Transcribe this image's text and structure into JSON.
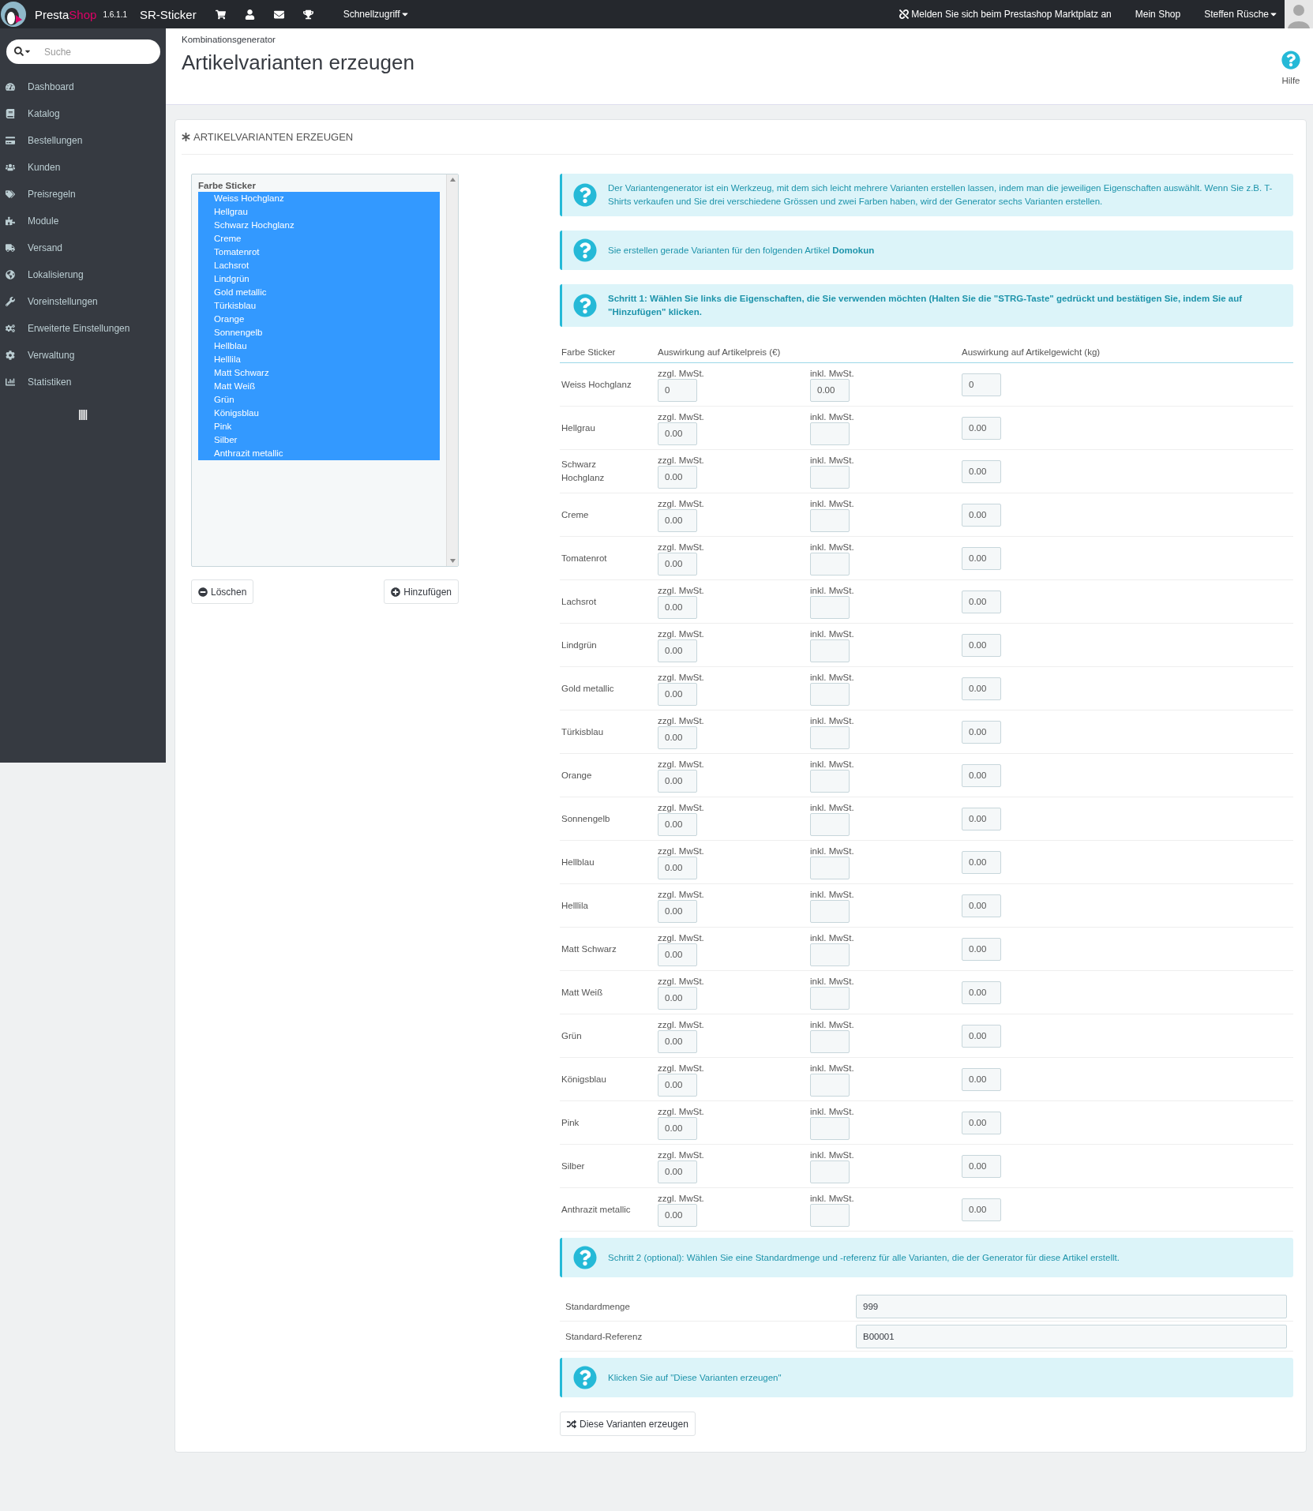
{
  "topbar": {
    "logo_main": "Presta",
    "logo_accent": "Shop",
    "version": "1.6.1.1",
    "shop_name": "SR-Sticker",
    "quick_access": "Schnellzugriff",
    "marketplace": "Melden Sie sich beim Prestashop Marktplatz an",
    "my_shop": "Mein Shop",
    "user": "Steffen Rüsche"
  },
  "sidebar": {
    "search_placeholder": "Suche",
    "items": [
      {
        "label": "Dashboard"
      },
      {
        "label": "Katalog"
      },
      {
        "label": "Bestellungen"
      },
      {
        "label": "Kunden"
      },
      {
        "label": "Preisregeln"
      },
      {
        "label": "Module"
      },
      {
        "label": "Versand"
      },
      {
        "label": "Lokalisierung"
      },
      {
        "label": "Voreinstellungen"
      },
      {
        "label": "Erweiterte Einstellungen"
      },
      {
        "label": "Verwaltung"
      },
      {
        "label": "Statistiken"
      }
    ]
  },
  "header": {
    "breadcrumb": "Kombinationsgenerator",
    "title": "Artikelvarianten erzeugen",
    "help": "Hilfe"
  },
  "panel": {
    "heading": "ARTIKELVARIANTEN ERZEUGEN",
    "attribute_list": {
      "group": "Farbe Sticker",
      "options": [
        {
          "label": "Weiss Hochglanz",
          "selected": true
        },
        {
          "label": "Hellgrau",
          "selected": true
        },
        {
          "label": "Schwarz Hochglanz",
          "selected": true
        },
        {
          "label": "Creme",
          "selected": true
        },
        {
          "label": "Tomatenrot",
          "selected": true
        },
        {
          "label": "Lachsrot",
          "selected": true
        },
        {
          "label": "Lindgrün",
          "selected": true
        },
        {
          "label": "Gold metallic",
          "selected": true
        },
        {
          "label": "Türkisblau",
          "selected": true
        },
        {
          "label": "Orange",
          "selected": true
        },
        {
          "label": "Sonnengelb",
          "selected": true
        },
        {
          "label": "Hellblau",
          "selected": true
        },
        {
          "label": "Helllila",
          "selected": true
        },
        {
          "label": "Matt Schwarz",
          "selected": true
        },
        {
          "label": "Matt Weiß",
          "selected": true
        },
        {
          "label": "Grün",
          "selected": true
        },
        {
          "label": "Königsblau",
          "selected": true
        },
        {
          "label": "Pink",
          "selected": true
        },
        {
          "label": "Silber",
          "selected": true
        },
        {
          "label": "Anthrazit metallic",
          "selected": true
        }
      ]
    },
    "delete_button": "Löschen",
    "add_button": "Hinzufügen",
    "infos": [
      {
        "text": "Der Variantengenerator ist ein Werkzeug, mit dem sich leicht mehrere Varianten erstellen lassen, indem man die jeweiligen Eigenschaften auswählt. Wenn Sie z.B. T-Shirts verkaufen und Sie drei verschiedene Grössen und zwei Farben haben, wird der Generator sechs Varianten erstellen.",
        "bold": false
      },
      {
        "text": "Sie erstellen gerade Varianten für den folgenden Artikel **Domokun**",
        "bold": false
      },
      {
        "text": "Schritt 1: Wählen Sie links die Eigenschaften, die Sie verwenden möchten (Halten Sie die \"STRG-Taste\" gedrückt und bestätigen Sie, indem Sie auf \"Hinzufügen\" klicken.",
        "bold": true
      }
    ],
    "table": {
      "columns": [
        "Farbe Sticker",
        "Auswirkung auf Artikelpreis (€)",
        "Auswirkung auf Artikelgewicht (kg)"
      ],
      "rows": [
        {
          "name": "Weiss Hochglanz",
          "excl_label": "zzgl. MwSt.",
          "excl": "0",
          "incl_label": "inkl. MwSt.",
          "incl": "0.00",
          "weight": "0"
        },
        {
          "name": "Hellgrau",
          "excl_label": "zzgl. MwSt.",
          "excl": "0.00",
          "incl_label": "inkl. MwSt.",
          "weight": "0.00"
        },
        {
          "name": "Schwarz Hochglanz",
          "excl_label": "zzgl. MwSt.",
          "excl": "0.00",
          "incl_label": "inkl. MwSt.",
          "weight": "0.00"
        },
        {
          "name": "Creme",
          "excl_label": "zzgl. MwSt.",
          "excl": "0.00",
          "incl_label": "inkl. MwSt.",
          "weight": "0.00"
        },
        {
          "name": "Tomatenrot",
          "excl_label": "zzgl. MwSt.",
          "excl": "0.00",
          "incl_label": "inkl. MwSt.",
          "weight": "0.00"
        },
        {
          "name": "Lachsrot",
          "excl_label": "zzgl. MwSt.",
          "excl": "0.00",
          "incl_label": "inkl. MwSt.",
          "weight": "0.00"
        },
        {
          "name": "Lindgrün",
          "excl_label": "zzgl. MwSt.",
          "excl": "0.00",
          "incl_label": "inkl. MwSt.",
          "weight": "0.00"
        },
        {
          "name": "Gold metallic",
          "excl_label": "zzgl. MwSt.",
          "excl": "0.00",
          "incl_label": "inkl. MwSt.",
          "weight": "0.00"
        },
        {
          "name": "Türkisblau",
          "excl_label": "zzgl. MwSt.",
          "excl": "0.00",
          "incl_label": "inkl. MwSt.",
          "weight": "0.00"
        },
        {
          "name": "Orange",
          "excl_label": "zzgl. MwSt.",
          "excl": "0.00",
          "incl_label": "inkl. MwSt.",
          "weight": "0.00"
        },
        {
          "name": "Sonnengelb",
          "excl_label": "zzgl. MwSt.",
          "excl": "0.00",
          "incl_label": "inkl. MwSt.",
          "weight": "0.00"
        },
        {
          "name": "Hellblau",
          "excl_label": "zzgl. MwSt.",
          "excl": "0.00",
          "incl_label": "inkl. MwSt.",
          "weight": "0.00"
        },
        {
          "name": "Helllila",
          "excl_label": "zzgl. MwSt.",
          "excl": "0.00",
          "incl_label": "inkl. MwSt.",
          "weight": "0.00"
        },
        {
          "name": "Matt Schwarz",
          "excl_label": "zzgl. MwSt.",
          "excl": "0.00",
          "incl_label": "inkl. MwSt.",
          "weight": "0.00"
        },
        {
          "name": "Matt Weiß",
          "excl_label": "zzgl. MwSt.",
          "excl": "0.00",
          "incl_label": "inkl. MwSt.",
          "weight": "0.00"
        },
        {
          "name": "Grün",
          "excl_label": "zzgl. MwSt.",
          "excl": "0.00",
          "incl_label": "inkl. MwSt.",
          "weight": "0.00"
        },
        {
          "name": "Königsblau",
          "excl_label": "zzgl. MwSt.",
          "excl": "0.00",
          "incl_label": "inkl. MwSt.",
          "weight": "0.00"
        },
        {
          "name": "Pink",
          "excl_label": "zzgl. MwSt.",
          "excl": "0.00",
          "incl_label": "inkl. MwSt.",
          "weight": "0.00"
        },
        {
          "name": "Silber",
          "excl_label": "zzgl. MwSt.",
          "excl": "0.00",
          "incl_label": "inkl. MwSt.",
          "weight": "0.00"
        },
        {
          "name": "Anthrazit metallic",
          "excl_label": "zzgl. MwSt.",
          "excl": "0.00",
          "incl_label": "inkl. MwSt.",
          "weight": "0.00"
        }
      ]
    },
    "step2_info": "Schritt 2 (optional): Wählen Sie eine Standardmenge und -referenz für alle Varianten, die der Generator für diese Artikel erstellt.",
    "defaults": [
      {
        "label": "Standardmenge",
        "value": "999"
      },
      {
        "label": "Standard-Referenz",
        "value": "B00001"
      }
    ],
    "step3_info": "Klicken Sie auf \"Diese Varianten erzeugen\"",
    "generate_button": "Diese Varianten erzeugen"
  }
}
